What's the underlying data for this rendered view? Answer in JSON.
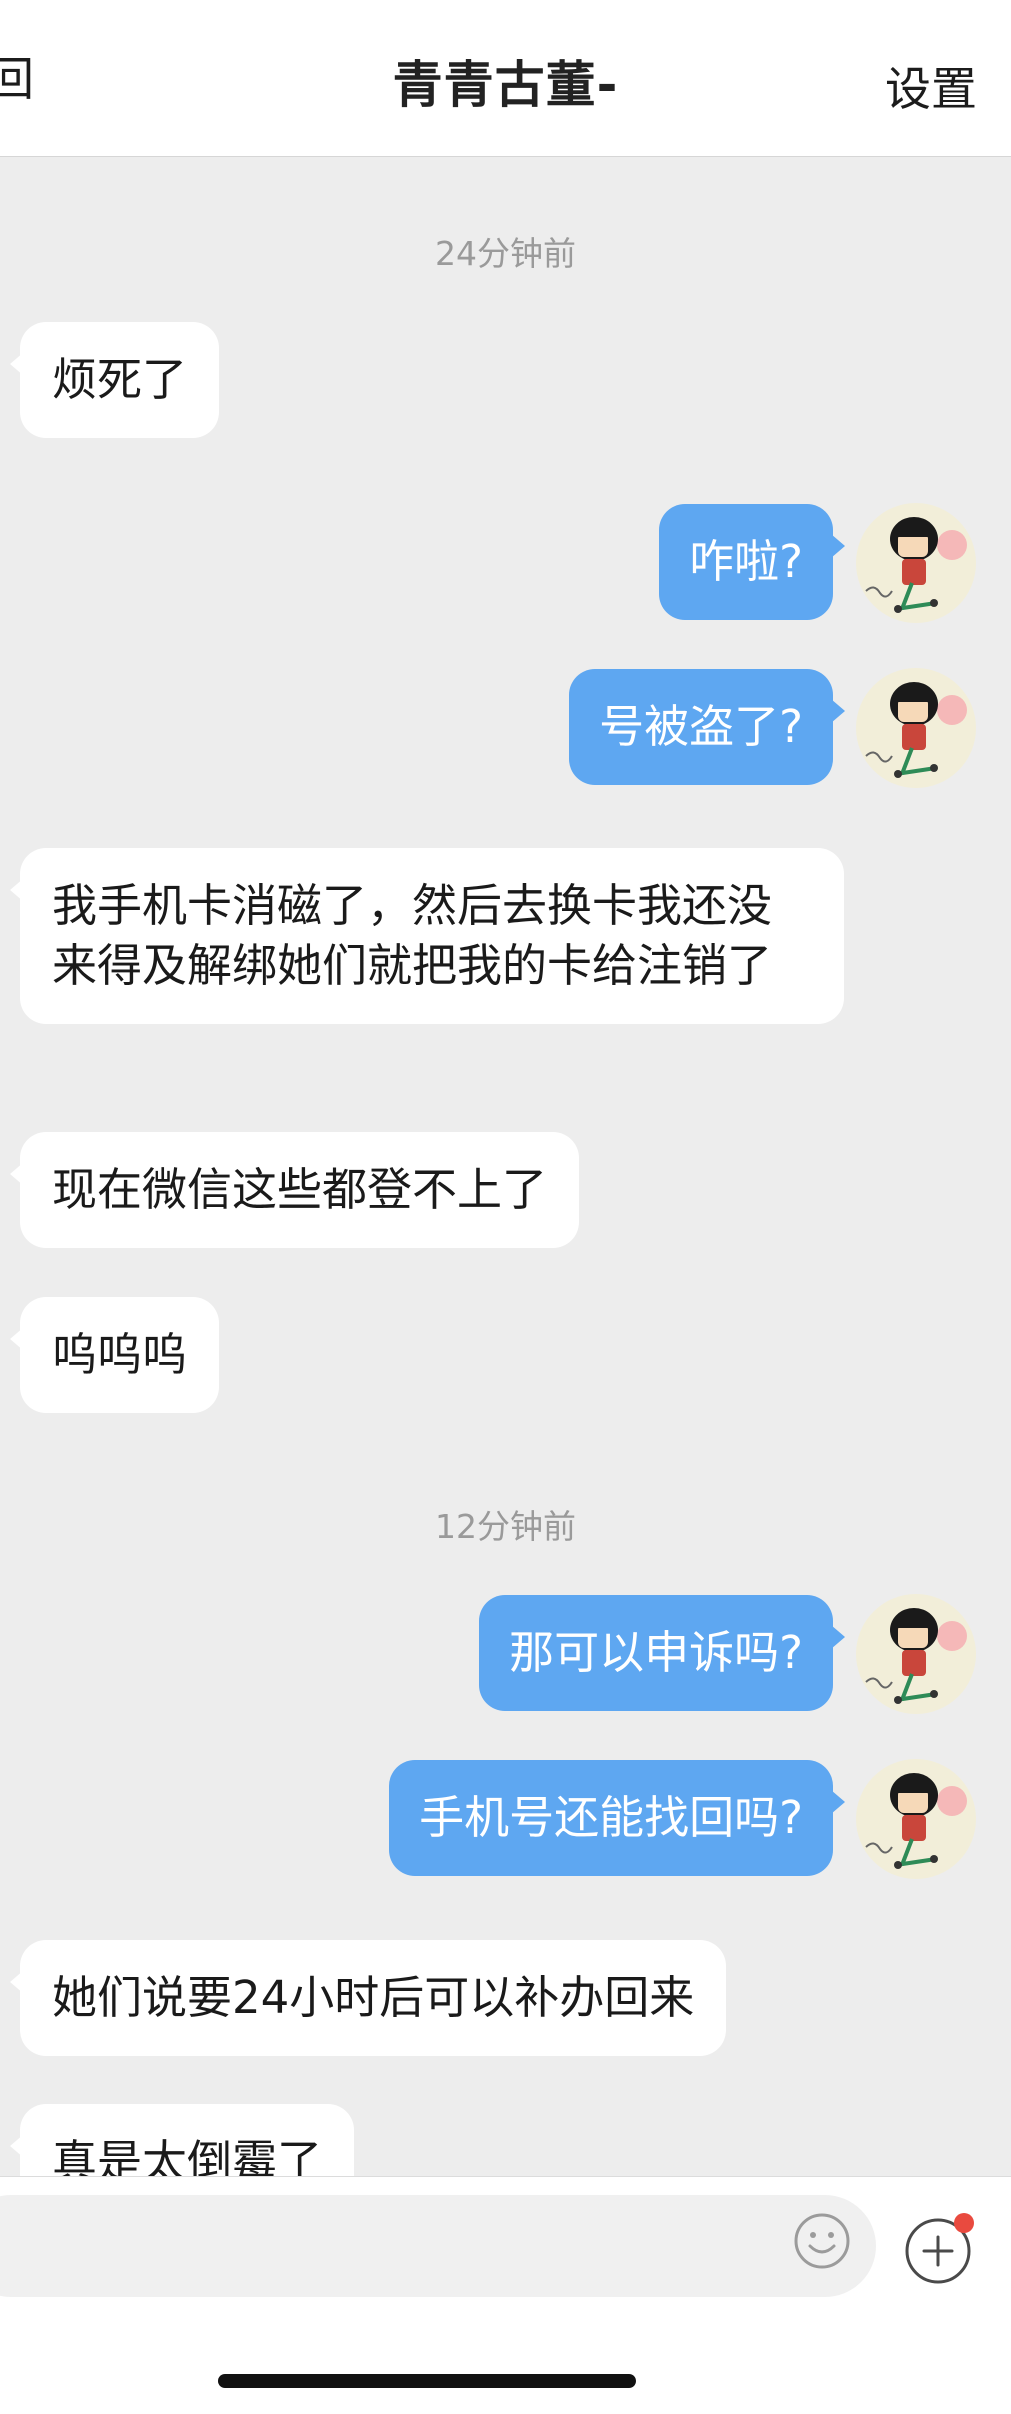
{
  "header": {
    "back_label": "回",
    "title": "青青古董-",
    "settings_label": "设置"
  },
  "conversation": {
    "time_1": "24分钟前",
    "time_2": "12分钟前",
    "msg_1": "烦死了",
    "msg_2": "咋啦?",
    "msg_3": "号被盗了?",
    "msg_4": "我手机卡消磁了，然后去换卡我还没来得及解绑她们就把我的卡给注销了",
    "msg_5": "现在微信这些都登不上了",
    "msg_6": "呜呜呜",
    "msg_7": "那可以申诉吗?",
    "msg_8": "手机号还能找回吗?",
    "msg_9": "她们说要24小时后可以补办回来",
    "msg_10": "真是太倒霉了"
  },
  "input": {
    "placeholder": ""
  },
  "icons": {
    "emoji": "smiley-face-icon",
    "more": "plus-circle-icon",
    "badge_color": "#e94a3f"
  },
  "colors": {
    "outgoing_bubble": "#5ea7f1",
    "incoming_bubble": "#ffffff",
    "chat_background": "#ededed"
  }
}
